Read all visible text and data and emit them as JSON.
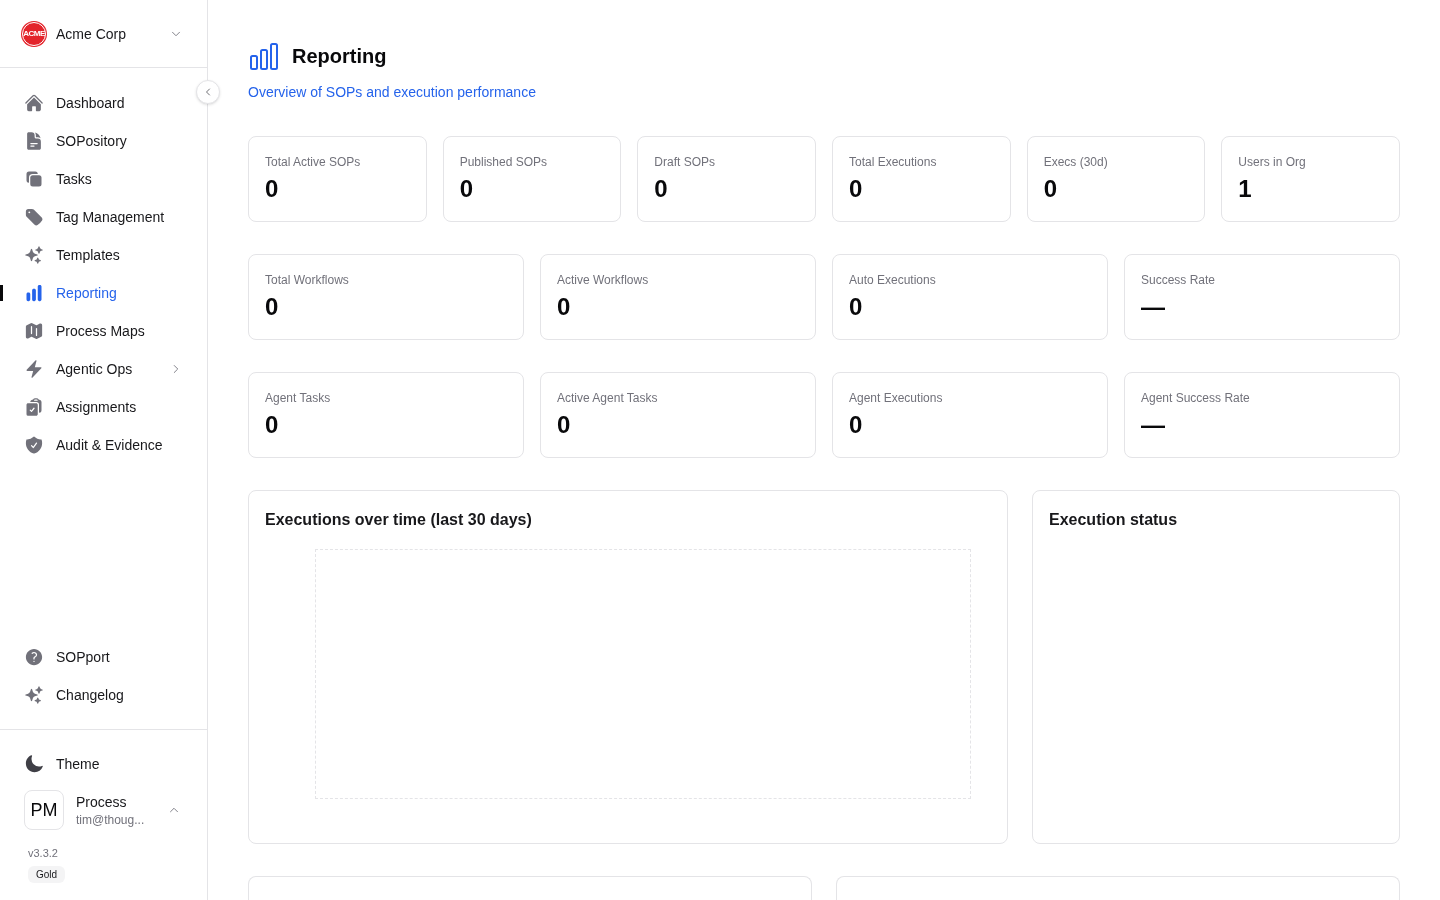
{
  "sidebar": {
    "org": {
      "logo_text": "ACME",
      "name": "Acme Corp"
    },
    "nav_items": [
      {
        "label": "Dashboard",
        "selected": false,
        "has_submenu": false
      },
      {
        "label": "SOPository",
        "selected": false,
        "has_submenu": false
      },
      {
        "label": "Tasks",
        "selected": false,
        "has_submenu": false
      },
      {
        "label": "Tag Management",
        "selected": false,
        "has_submenu": false
      },
      {
        "label": "Templates",
        "selected": false,
        "has_submenu": false
      },
      {
        "label": "Reporting",
        "selected": true,
        "has_submenu": false
      },
      {
        "label": "Process Maps",
        "selected": false,
        "has_submenu": false
      },
      {
        "label": "Agentic Ops",
        "selected": false,
        "has_submenu": true
      },
      {
        "label": "Assignments",
        "selected": false,
        "has_submenu": false
      },
      {
        "label": "Audit & Evidence",
        "selected": false,
        "has_submenu": false
      }
    ],
    "help_items": [
      {
        "label": "SOPport"
      },
      {
        "label": "Changelog"
      }
    ],
    "theme": {
      "label": "Theme"
    },
    "user": {
      "initials": "PM",
      "name": "Process",
      "email": "tim@thoug..."
    },
    "version": "v3.3.2",
    "plan_badge": "Gold"
  },
  "header": {
    "title": "Reporting",
    "subtitle": "Overview of SOPs and execution performance"
  },
  "stat_rows": [
    [
      {
        "label": "Total Active SOPs",
        "value": "0"
      },
      {
        "label": "Published SOPs",
        "value": "0"
      },
      {
        "label": "Draft SOPs",
        "value": "0"
      },
      {
        "label": "Total Executions",
        "value": "0"
      },
      {
        "label": "Execs (30d)",
        "value": "0"
      },
      {
        "label": "Users in Org",
        "value": "1"
      }
    ],
    [
      {
        "label": "Total Workflows",
        "value": "0"
      },
      {
        "label": "Active Workflows",
        "value": "0"
      },
      {
        "label": "Auto Executions",
        "value": "0"
      },
      {
        "label": "Success Rate",
        "value": "—"
      }
    ],
    [
      {
        "label": "Agent Tasks",
        "value": "0"
      },
      {
        "label": "Active Agent Tasks",
        "value": "0"
      },
      {
        "label": "Agent Executions",
        "value": "0"
      },
      {
        "label": "Agent Success Rate",
        "value": "—"
      }
    ]
  ],
  "panels": [
    {
      "title": "Executions over time (last 30 days)",
      "kind": "chart"
    },
    {
      "title": "Execution status",
      "kind": "blank"
    }
  ]
}
